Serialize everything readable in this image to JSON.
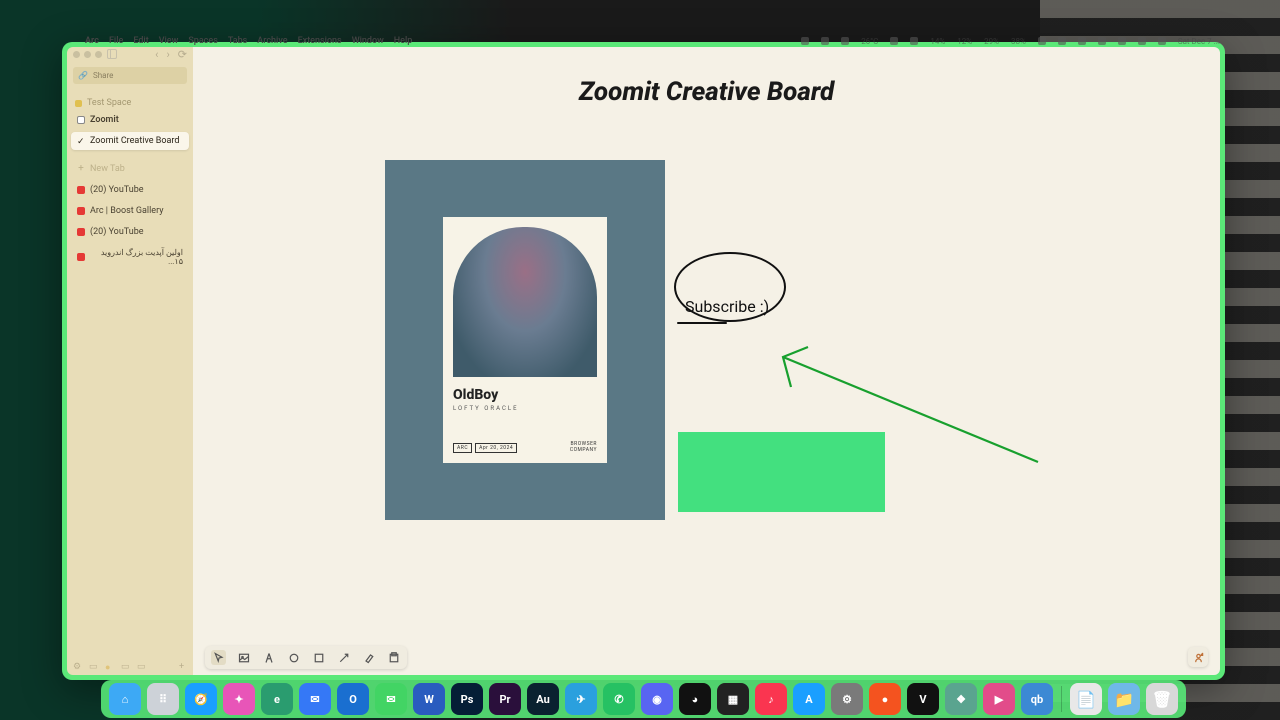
{
  "menubar": {
    "items": [
      "Arc",
      "File",
      "Edit",
      "View",
      "Spaces",
      "Tabs",
      "Archive",
      "Extensions",
      "Window",
      "Help"
    ],
    "right": [
      "26°C",
      "14%",
      "12%",
      "29%",
      "38%",
      "Sat Dec 7 ..."
    ]
  },
  "sidebar": {
    "share": "Share",
    "space": "Test Space",
    "zoomit": "Zoomit",
    "easel": "Zoomit Creative Board",
    "newtab": "New Tab",
    "items": [
      "(20) YouTube",
      "Arc | Boost Gallery",
      "(20) YouTube",
      "اولین آپدیت بزرگ اندروید ۱۵..."
    ]
  },
  "board": {
    "title": "Zoomit Creative Board",
    "card": {
      "h1": "OldBoy",
      "h2": "LOFTY ORACLE",
      "pill1": "ARC",
      "pill2": "Apr 20, 2024",
      "brand": "BROWSER\nCOMPANY"
    },
    "subscribe": "Subscribe :)"
  },
  "dock": {
    "apps": [
      "Finder",
      "Launchpad",
      "Safari",
      "Arc",
      "Edge",
      "Mail",
      "Outlook",
      "Messages",
      "Word",
      "Photoshop",
      "Premiere",
      "Audition",
      "Telegram",
      "WhatsApp",
      "Discord",
      "Obsidian",
      "Calculator",
      "Music",
      "AppStore",
      "Settings",
      "Brave",
      "VPN",
      "ChatGPT",
      "Media",
      "qBit"
    ],
    "colors": [
      "#3da9f5",
      "#cdd2d8",
      "#1a9fff",
      "#e855b8",
      "#2a9c6f",
      "#3578f6",
      "#1a6fd0",
      "#42d464",
      "#2a5cbf",
      "#051e36",
      "#2a0f3b",
      "#0a2230",
      "#2aa0de",
      "#26c163",
      "#5865f2",
      "#111",
      "#222",
      "#fa3550",
      "#1a9fff",
      "#7a7a7a",
      "#f4531f",
      "#111",
      "#5aa48f",
      "#e24c8a",
      "#3c89d4"
    ]
  }
}
